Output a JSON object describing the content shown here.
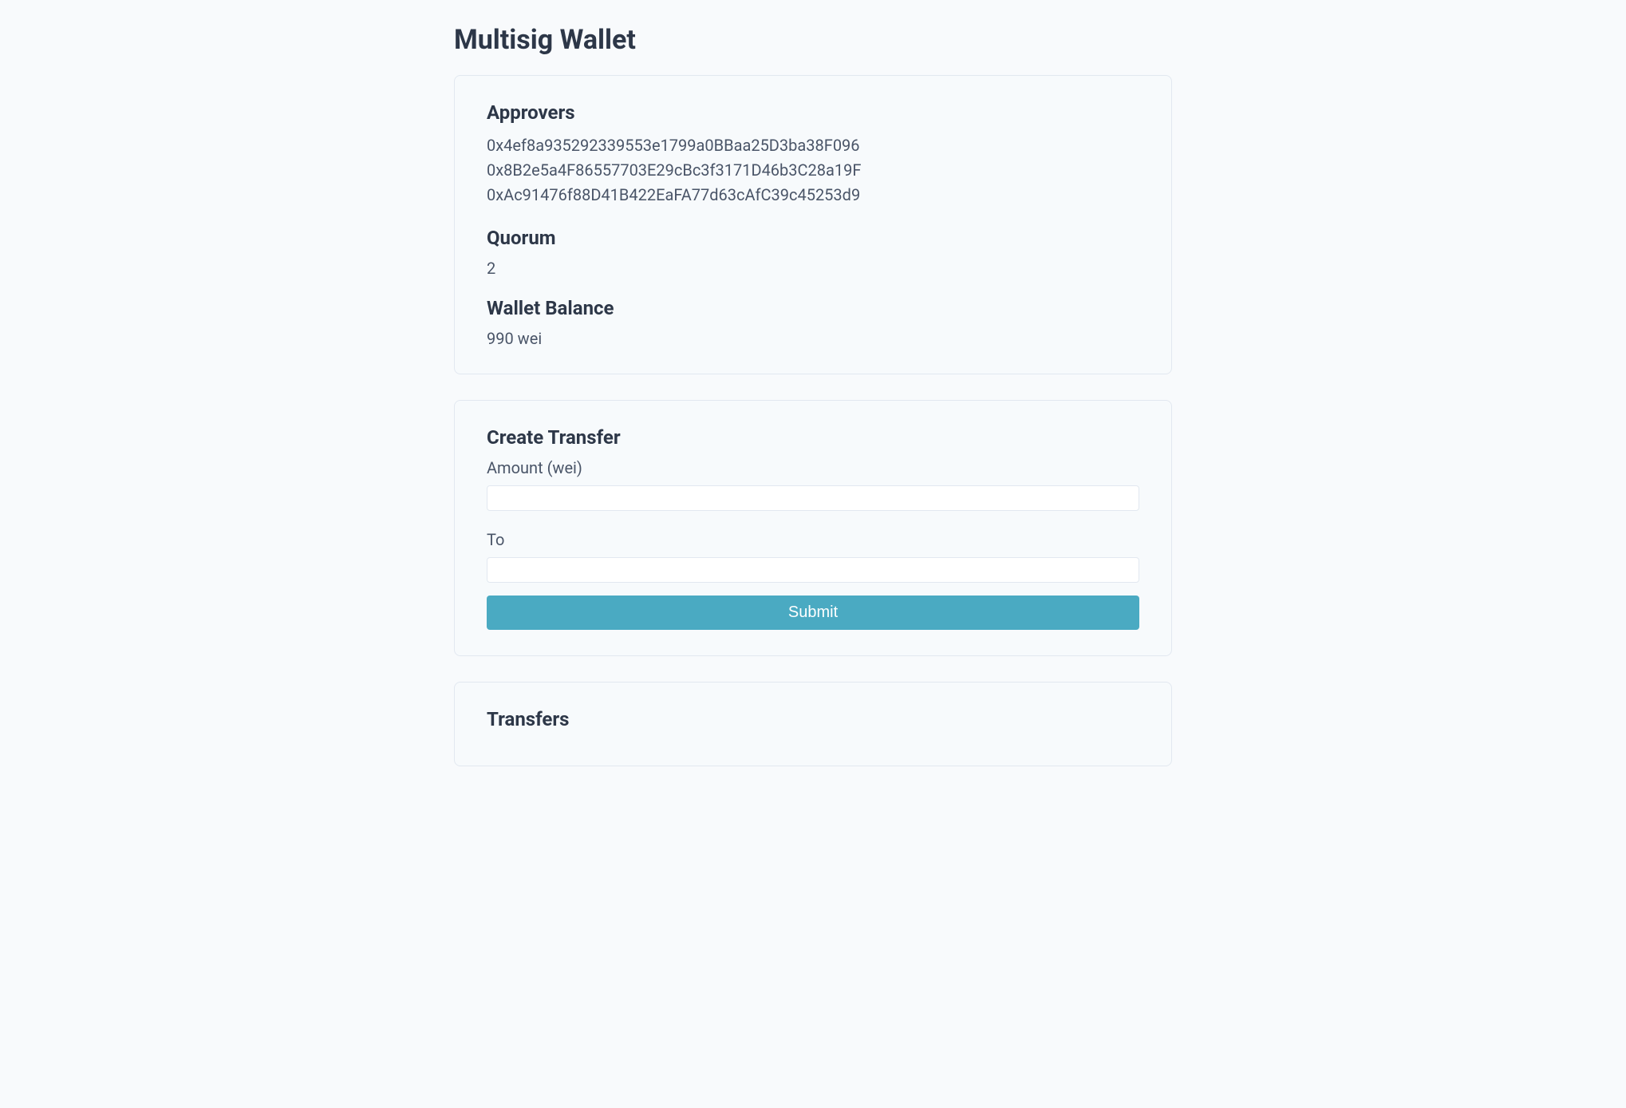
{
  "page_title": "Multisig Wallet",
  "info_card": {
    "approvers_heading": "Approvers",
    "approvers": [
      "0x4ef8a935292339553e1799a0BBaa25D3ba38F096",
      "0x8B2e5a4F86557703E29cBc3f3171D46b3C28a19F",
      "0xAc91476f88D41B422EaFA77d63cAfC39c45253d9"
    ],
    "quorum_heading": "Quorum",
    "quorum_value": "2",
    "balance_heading": "Wallet Balance",
    "balance_value": "990 wei"
  },
  "create_transfer": {
    "heading": "Create Transfer",
    "amount_label": "Amount (wei)",
    "to_label": "To",
    "submit_label": "Submit"
  },
  "transfers": {
    "heading": "Transfers"
  }
}
